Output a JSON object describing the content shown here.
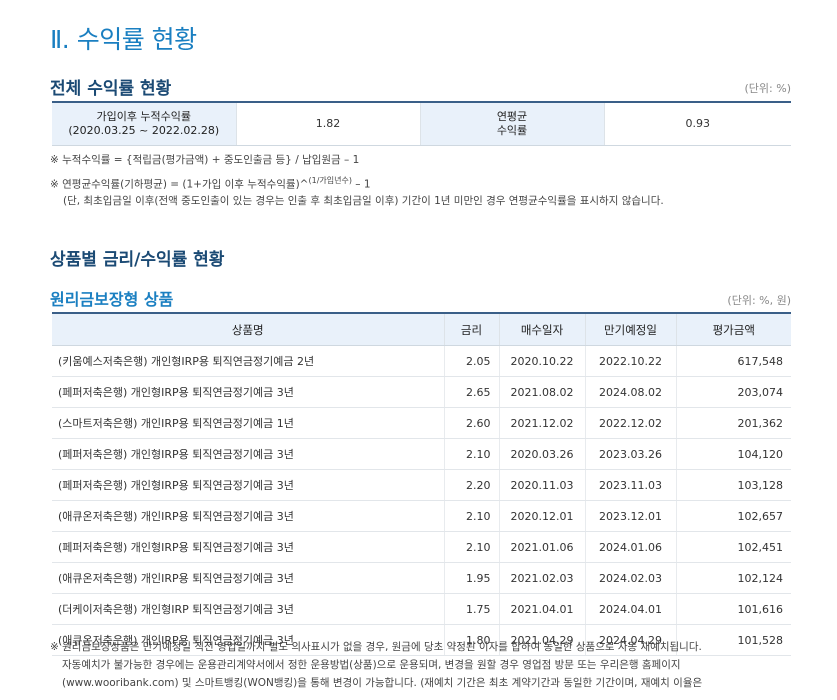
{
  "page_title": "Ⅱ. 수익률 현황",
  "overall": {
    "title": "전체 수익률 현황",
    "unit": "(단위: %)",
    "cum_label_1": "가입이후 누적수익률",
    "cum_label_2": "(2020.03.25 ~ 2022.02.28)",
    "cum_value": "1.82",
    "ann_label_1": "연평균",
    "ann_label_2": "수익률",
    "ann_value": "0.93"
  },
  "notes": {
    "line1": "※ 누적수익률 = {적립금(평가금액) + 중도인출금 등} / 납입원금 – 1",
    "line2_pre": "※ 연평균수익률(기하평균) = (1+가입 이후 누적수익률)^",
    "line2_sup": "(1/가입년수)",
    "line2_post": " – 1",
    "line3": "(단, 최초입금일 이후(전액 중도인출이 있는 경우는 인출 후 최초입금일 이후) 기간이 1년 미만인 경우 연평균수익률을 표시하지 않습니다."
  },
  "section2_title": "상품별 금리/수익률 현황",
  "principal": {
    "title": "원리금보장형 상품",
    "unit": "(단위: %, 원)",
    "headers": [
      "상품명",
      "금리",
      "매수일자",
      "만기예정일",
      "평가금액"
    ],
    "rows": [
      {
        "name": "(키움예스저축은행) 개인형IRP용 퇴직연금정기예금 2년",
        "rate": "2.05",
        "buy": "2020.10.22",
        "maturity": "2022.10.22",
        "amount": "617,548"
      },
      {
        "name": "(페퍼저축은행) 개인형IRP용 퇴직연금정기예금 3년",
        "rate": "2.65",
        "buy": "2021.08.02",
        "maturity": "2024.08.02",
        "amount": "203,074"
      },
      {
        "name": "(스마트저축은행) 개인IRP용 퇴직연금정기예금 1년",
        "rate": "2.60",
        "buy": "2021.12.02",
        "maturity": "2022.12.02",
        "amount": "201,362"
      },
      {
        "name": "(페퍼저축은행) 개인형IRP용 퇴직연금정기예금 3년",
        "rate": "2.10",
        "buy": "2020.03.26",
        "maturity": "2023.03.26",
        "amount": "104,120"
      },
      {
        "name": "(페퍼저축은행) 개인형IRP용 퇴직연금정기예금 3년",
        "rate": "2.20",
        "buy": "2020.11.03",
        "maturity": "2023.11.03",
        "amount": "103,128"
      },
      {
        "name": "(애큐온저축은행) 개인IRP용 퇴직연금정기예금 3년",
        "rate": "2.10",
        "buy": "2020.12.01",
        "maturity": "2023.12.01",
        "amount": "102,657"
      },
      {
        "name": "(페퍼저축은행) 개인형IRP용 퇴직연금정기예금 3년",
        "rate": "2.10",
        "buy": "2021.01.06",
        "maturity": "2024.01.06",
        "amount": "102,451"
      },
      {
        "name": "(애큐온저축은행) 개인IRP용 퇴직연금정기예금 3년",
        "rate": "1.95",
        "buy": "2021.02.03",
        "maturity": "2024.02.03",
        "amount": "102,124"
      },
      {
        "name": "(더케이저축은행) 개인형IRP 퇴직연금정기예금 3년",
        "rate": "1.75",
        "buy": "2021.04.01",
        "maturity": "2024.04.01",
        "amount": "101,616"
      },
      {
        "name": "(애큐온저축은행) 개인IRP용 퇴직연금정기예금 3년",
        "rate": "1.80",
        "buy": "2021.04.29",
        "maturity": "2024.04.29",
        "amount": "101,528"
      }
    ]
  },
  "footnote": {
    "line1": "※ 원리금보장상품은 만기예정일 직전 영업일까지 별도 의사표시가 없을 경우, 원금에 당초 약정된 이자를 합하여 동일한 상품으로 자동 재예치됩니다.",
    "line2": "자동예치가 불가능한 경우에는 운용관리계약서에서 정한 운용방법(상품)으로 운용되며, 변경을 원할 경우 영업점 방문 또는 우리은행 홈페이지",
    "line3": "(www.wooribank.com) 및 스마트뱅킹(WON뱅킹)을 통해 변경이 가능합니다. (재예치 기간은 최초 계약기간과 동일한 기간이며, 재예치 이율은"
  }
}
